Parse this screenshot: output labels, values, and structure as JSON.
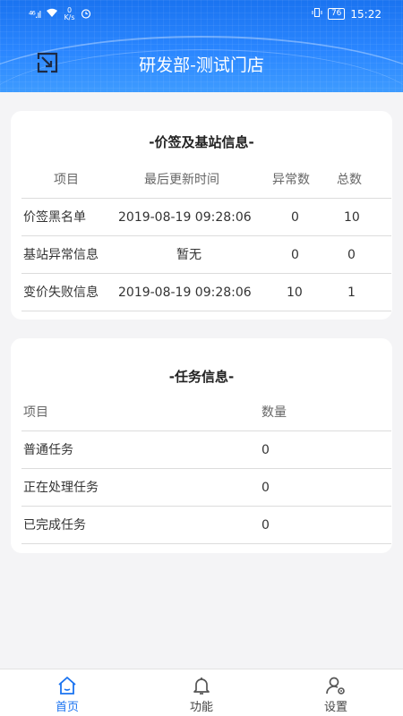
{
  "status_bar": {
    "signal": "⁴⁶.ıl",
    "speed_value": "0",
    "speed_unit": "K/s",
    "battery": "76",
    "time": "15:22"
  },
  "header": {
    "title": "研发部-测试门店"
  },
  "card1": {
    "title": "-价签及基站信息-",
    "columns": [
      "项目",
      "最后更新时间",
      "异常数",
      "总数"
    ],
    "rows": [
      {
        "item": "价签黑名单",
        "time": "2019-08-19 09:28:06",
        "abnormal": "0",
        "total": "10"
      },
      {
        "item": "基站异常信息",
        "time": "暂无",
        "abnormal": "0",
        "total": "0"
      },
      {
        "item": "变价失败信息",
        "time": "2019-08-19 09:28:06",
        "abnormal": "10",
        "total": "1"
      }
    ]
  },
  "card2": {
    "title": "-任务信息-",
    "columns": [
      "项目",
      "数量"
    ],
    "rows": [
      {
        "item": "普通任务",
        "count": "0"
      },
      {
        "item": "正在处理任务",
        "count": "0"
      },
      {
        "item": "已完成任务",
        "count": "0"
      }
    ]
  },
  "bottom_nav": {
    "items": [
      {
        "label": "首页",
        "icon": "home-icon",
        "active": true
      },
      {
        "label": "功能",
        "icon": "bell-icon",
        "active": false
      },
      {
        "label": "设置",
        "icon": "user-settings-icon",
        "active": false
      }
    ],
    "active_color": "#1a73f0"
  },
  "colors": {
    "header_blue": "#2a86ff",
    "background": "#f4f4f6"
  }
}
